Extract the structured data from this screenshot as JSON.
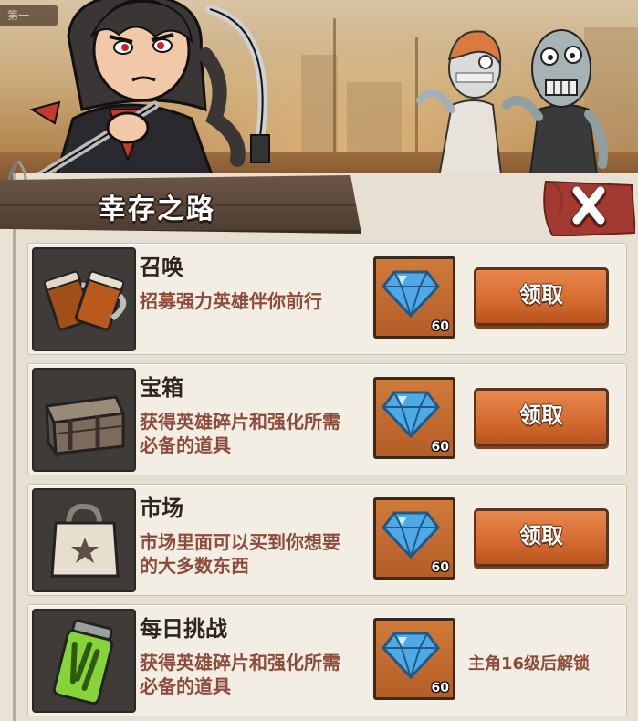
{
  "scene": {
    "stage_label": "第一"
  },
  "header": {
    "title": "幸存之路",
    "close_label": "关闭"
  },
  "rows": [
    {
      "name": "召唤",
      "desc": "招募强力英雄伴你前行",
      "icon": "beer-mugs-icon",
      "cost_amount": "60",
      "cost_icon": "diamond-icon",
      "action_label": "领取"
    },
    {
      "name": "宝箱",
      "desc": "获得英雄碎片和强化所需必备的道具",
      "icon": "treasure-chest-icon",
      "cost_amount": "60",
      "cost_icon": "diamond-icon",
      "action_label": "领取"
    },
    {
      "name": "市场",
      "desc": "市场里面可以买到你想要的大多数东西",
      "icon": "shopping-bag-icon",
      "cost_amount": "60",
      "cost_icon": "diamond-icon",
      "action_label": "领取"
    },
    {
      "name": "每日挑战",
      "desc": "获得英雄碎片和强化所需必备的道具",
      "icon": "energy-drink-can-icon",
      "cost_amount": "60",
      "cost_icon": "diamond-icon",
      "locked_text": "主角16级后解锁"
    }
  ],
  "colors": {
    "accent_button": "#d46a2e",
    "desc_text": "#8e4b3a",
    "cost_bg": "#c46a30",
    "panel_bg": "#e6dfd2"
  }
}
